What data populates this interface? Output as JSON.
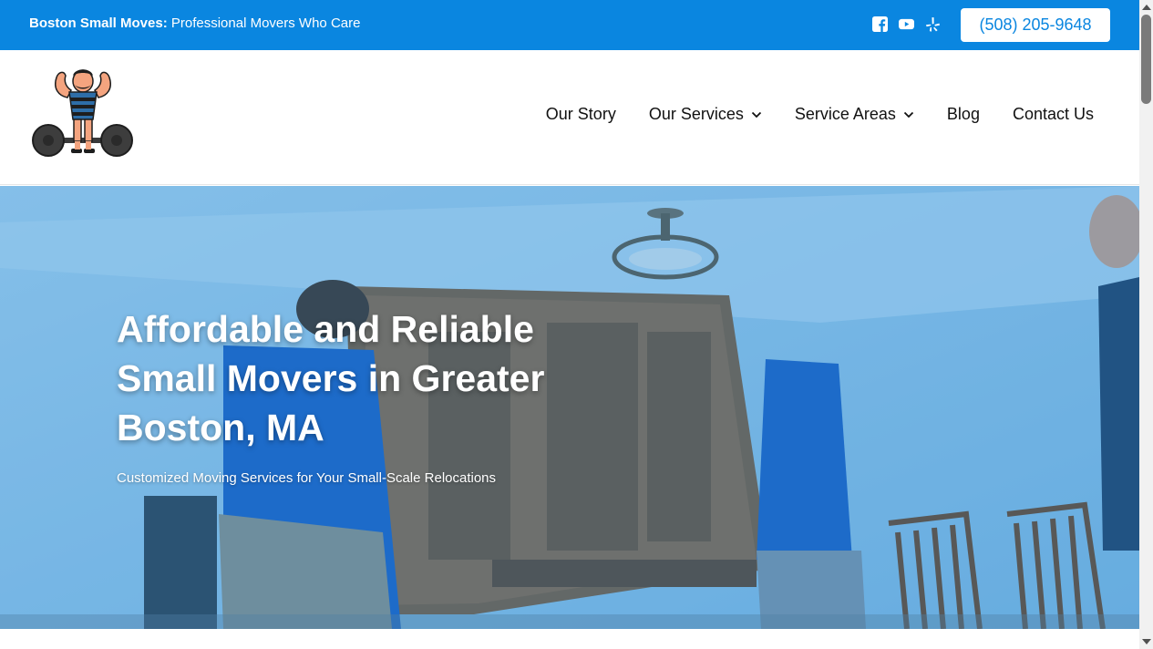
{
  "topbar": {
    "brand": "Boston Small Moves:",
    "tagline": "Professional Movers Who Care",
    "social_icons": [
      "facebook-icon",
      "youtube-icon",
      "yelp-icon"
    ],
    "phone": "(508) 205-9648",
    "background_color": "#0a86e0"
  },
  "nav": {
    "items": [
      {
        "label": "Our Story",
        "has_dropdown": false
      },
      {
        "label": "Our Services",
        "has_dropdown": true
      },
      {
        "label": "Service Areas",
        "has_dropdown": true
      },
      {
        "label": "Blog",
        "has_dropdown": false
      },
      {
        "label": "Contact Us",
        "has_dropdown": false
      }
    ]
  },
  "hero": {
    "title": "Affordable and Reliable Small Movers in Greater Boston, MA",
    "subtitle": "Customized Moving Services for Your Small-Scale Relocations"
  },
  "colors": {
    "accent": "#0a86e0",
    "nav_text": "#111111"
  }
}
